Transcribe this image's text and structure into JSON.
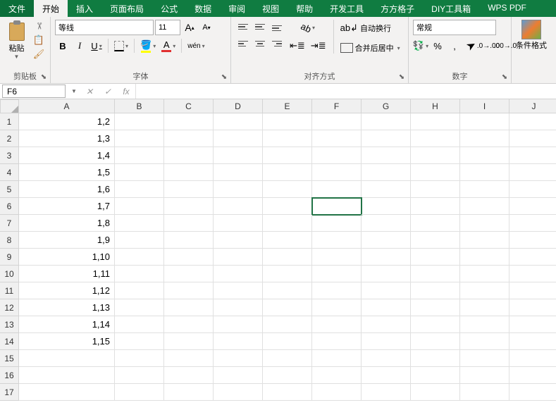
{
  "tabs": {
    "file": "文件",
    "home": "开始",
    "insert": "插入",
    "layout": "页面布局",
    "formula": "公式",
    "data": "数据",
    "review": "审阅",
    "view": "视图",
    "help": "帮助",
    "dev": "开发工具",
    "fangfang": "方方格子",
    "diy": "DIY工具箱",
    "wps": "WPS PDF"
  },
  "ribbon": {
    "clipboard": {
      "label": "剪贴板",
      "paste": "粘贴"
    },
    "font": {
      "label": "字体",
      "name": "等线",
      "size": "11",
      "bold": "B",
      "italic": "I",
      "underline": "U",
      "increase": "A",
      "decrease": "A",
      "fontcolor": "A",
      "wen": "wén"
    },
    "alignment": {
      "label": "对齐方式",
      "wrap": "自动换行",
      "merge": "合并后居中"
    },
    "number": {
      "label": "数字",
      "format": "常规",
      "percent": "%",
      "comma": ","
    },
    "condfmt": "条件格式"
  },
  "namebox": "F6",
  "formula_fx": "fx",
  "columns": [
    "A",
    "B",
    "C",
    "D",
    "E",
    "F",
    "G",
    "H",
    "I",
    "J"
  ],
  "rows": [
    1,
    2,
    3,
    4,
    5,
    6,
    7,
    8,
    9,
    10,
    11,
    12,
    13,
    14,
    15,
    16,
    17
  ],
  "cells": {
    "A1": "1,2",
    "A2": "1,3",
    "A3": "1,4",
    "A4": "1,5",
    "A5": "1,6",
    "A6": "1,7",
    "A7": "1,8",
    "A8": "1,9",
    "A9": "1,10",
    "A10": "1,11",
    "A11": "1,12",
    "A12": "1,13",
    "A13": "1,14",
    "A14": "1,15"
  },
  "selected": {
    "row": 6,
    "col": "F"
  }
}
